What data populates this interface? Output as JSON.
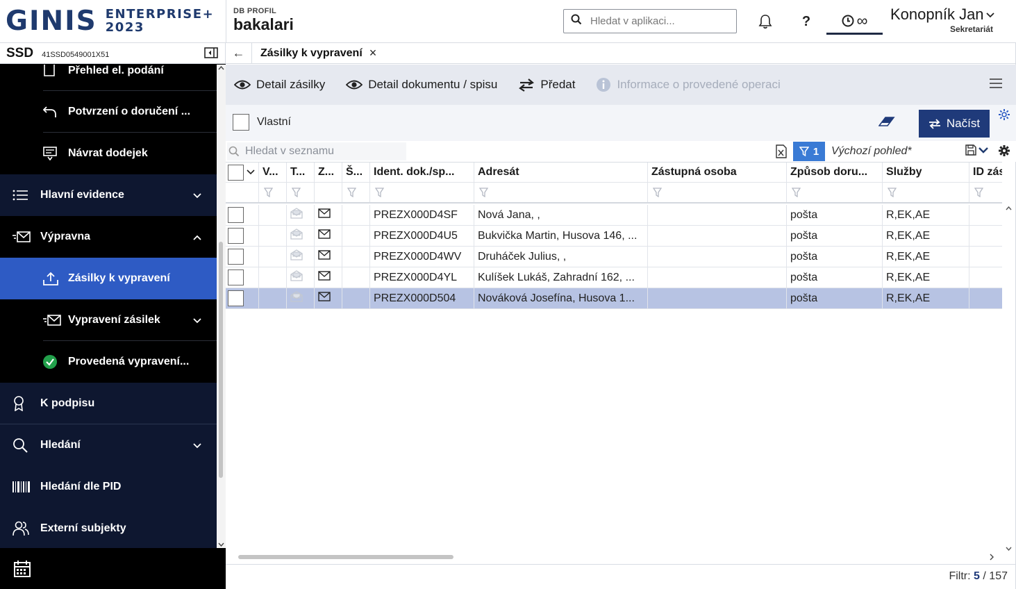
{
  "header": {
    "logo_main": "GINIS",
    "logo_line1": "ENTERPRISE+",
    "logo_line2": "2023",
    "db_label": "DB PROFIL",
    "db_name": "bakalari",
    "search_placeholder": "Hledat v aplikaci...",
    "help_label": "?",
    "timer_label": "∞",
    "user_name": "Konopník Jan",
    "user_role": "Sekretariát"
  },
  "sidebar": {
    "org_short": "SSD",
    "org_code": "41SSD0549001X51",
    "items": [
      {
        "label": "Přehled el. podání",
        "icon": "document-icon"
      },
      {
        "label": "Potvrzení o doručení ...",
        "icon": "undo-arrow-icon"
      },
      {
        "label": "Návrat dodejek",
        "icon": "return-receipt-icon"
      },
      {
        "label": "Hlavní evidence",
        "icon": "list-icon"
      },
      {
        "label": "Výpravna",
        "icon": "mail-send-icon"
      },
      {
        "label": "Zásilky k vypravení",
        "icon": "upload-icon"
      },
      {
        "label": "Vypravení zásilek",
        "icon": "mail-send-icon"
      },
      {
        "label": "Provedená vypravení...",
        "icon": "check-circle-icon"
      },
      {
        "label": "K podpisu",
        "icon": "ribbon-icon"
      },
      {
        "label": "Hledání",
        "icon": "search-icon"
      },
      {
        "label": "Hledání dle PID",
        "icon": "barcode-icon"
      },
      {
        "label": "Externí subjekty",
        "icon": "users-icon"
      }
    ]
  },
  "tab": {
    "title": "Zásilky k vypravení",
    "close": "×",
    "back": "←"
  },
  "toolbar": {
    "detail_zasilky": "Detail zásilky",
    "detail_dokumentu": "Detail dokumentu / spisu",
    "predat": "Předat",
    "informace": "Informace o provedené operaci"
  },
  "filter": {
    "vlastni": "Vlastní",
    "nacist": "Načíst"
  },
  "grid_toolbar": {
    "search_placeholder": "Hledat v seznamu",
    "filter_count": "1",
    "view_name": "Výchozí pohled*"
  },
  "columns": [
    "V...",
    "T...",
    "Z...",
    "Š...",
    "Ident. dok./sp...",
    "Adresát",
    "Zástupná osoba",
    "Způsob doru...",
    "Služby",
    "ID zás"
  ],
  "rows": [
    {
      "ident": "PREZX000D4SF",
      "adresat": "Nová Jana, ,",
      "zastupna": "",
      "zpusob": "pošta",
      "sluzby": "R,EK,AE",
      "selected": false
    },
    {
      "ident": "PREZX000D4U5",
      "adresat": "Bukvička Martin, Husova 146, ...",
      "zastupna": "",
      "zpusob": "pošta",
      "sluzby": "R,EK,AE",
      "selected": false
    },
    {
      "ident": "PREZX000D4WV",
      "adresat": "Druháček Julius, ,",
      "zastupna": "",
      "zpusob": "pošta",
      "sluzby": "R,EK,AE",
      "selected": false
    },
    {
      "ident": "PREZX000D4YL",
      "adresat": "Kulíšek Lukáš, Zahradní 162, ...",
      "zastupna": "",
      "zpusob": "pošta",
      "sluzby": "R,EK,AE",
      "selected": false
    },
    {
      "ident": "PREZX000D504",
      "adresat": "Nováková Josefína, Husova 1...",
      "zastupna": "",
      "zpusob": "pošta",
      "sluzby": "R,EK,AE",
      "selected": true
    }
  ],
  "status": {
    "filtr_label": "Filtr:",
    "filtr_count": "5",
    "filtr_sep": "/",
    "filtr_total": "157"
  },
  "colors": {
    "brand": "#1f3a6e",
    "sidebar_active": "#2e5bc4",
    "sidebar_section": "#0e1730",
    "button_primary": "#1f3a7a",
    "row_selected": "#b7c3e3",
    "filter_chip": "#3a7bd5"
  }
}
